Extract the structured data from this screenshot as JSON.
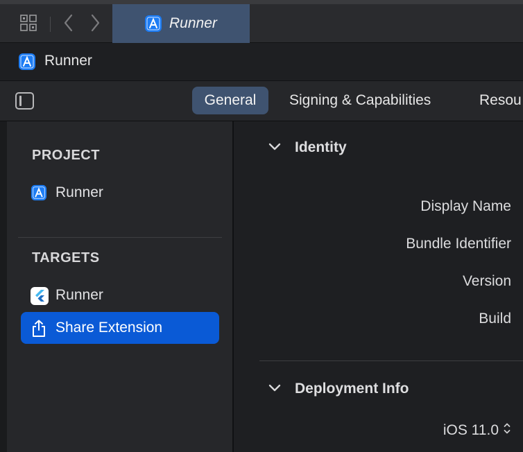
{
  "tabbar": {
    "active_tab_label": "Runner",
    "icons": [
      "grid-icon",
      "back-chevron-icon",
      "forward-chevron-icon",
      "xcode-app-icon"
    ]
  },
  "jumpbar": {
    "label": "Runner"
  },
  "editor_tabs": {
    "general": "General",
    "signing": "Signing & Capabilities",
    "resources": "Resou"
  },
  "sidebar": {
    "project_header": "PROJECT",
    "project_items": [
      {
        "label": "Runner",
        "icon": "xcode-app-icon"
      }
    ],
    "targets_header": "TARGETS",
    "target_items": [
      {
        "label": "Runner",
        "icon": "flutter-icon"
      },
      {
        "label": "Share Extension",
        "icon": "share-icon",
        "selected": true
      }
    ]
  },
  "main": {
    "identity": {
      "title": "Identity",
      "fields": [
        "Display Name",
        "Bundle Identifier",
        "Version",
        "Build"
      ]
    },
    "deployment": {
      "title": "Deployment Info",
      "ios_version": "iOS 11.0"
    }
  },
  "colors": {
    "accent": "#0a5ad6",
    "tab_selected": "#3f5370",
    "background": "#1e1f22",
    "sidebar": "#26272a"
  }
}
